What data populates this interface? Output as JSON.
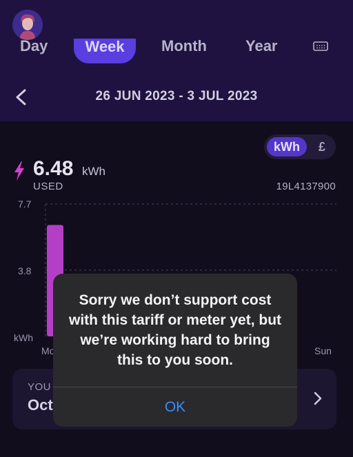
{
  "tabs": [
    {
      "label": "Day"
    },
    {
      "label": "Week"
    },
    {
      "label": "Month"
    },
    {
      "label": "Year"
    }
  ],
  "active_tab": "Week",
  "icons": {
    "avatar": "avatar-icon",
    "calendar": "calendar-icon",
    "back": "chevron-left-icon",
    "bolt": "lightning-bolt-icon",
    "card_chevron": "chevron-right-icon"
  },
  "date_range": "26 JUN 2023 - 3 JUL 2023",
  "unit_toggle": {
    "kwh": "kWh",
    "gbp": "£",
    "selected": "kWh"
  },
  "usage": {
    "value": "6.48",
    "unit": "kWh",
    "label": "USED"
  },
  "meter_id": "19L4137900",
  "chart_data": {
    "type": "bar",
    "categories": [
      "Mo",
      "Sun"
    ],
    "values": [
      6.48
    ],
    "yticks": [
      "7.7",
      "3.8"
    ],
    "ylabel": "kWh",
    "ylim": [
      0,
      7.7
    ],
    "bar_color": "#b43fc6",
    "grid": "dashed"
  },
  "card": {
    "label": "YOU",
    "value": "Oct"
  },
  "dialog": {
    "message": "Sorry we don’t support cost with this tariff or meter yet, but we’re working hard to bring this to you soon.",
    "ok_label": "OK"
  },
  "colors": {
    "header_bg": "#1f1240",
    "accent": "#5b3ee0",
    "bolt": "#d53fd0",
    "dialog_bg": "#2a2a2c",
    "dialog_action": "#3b8cff"
  }
}
